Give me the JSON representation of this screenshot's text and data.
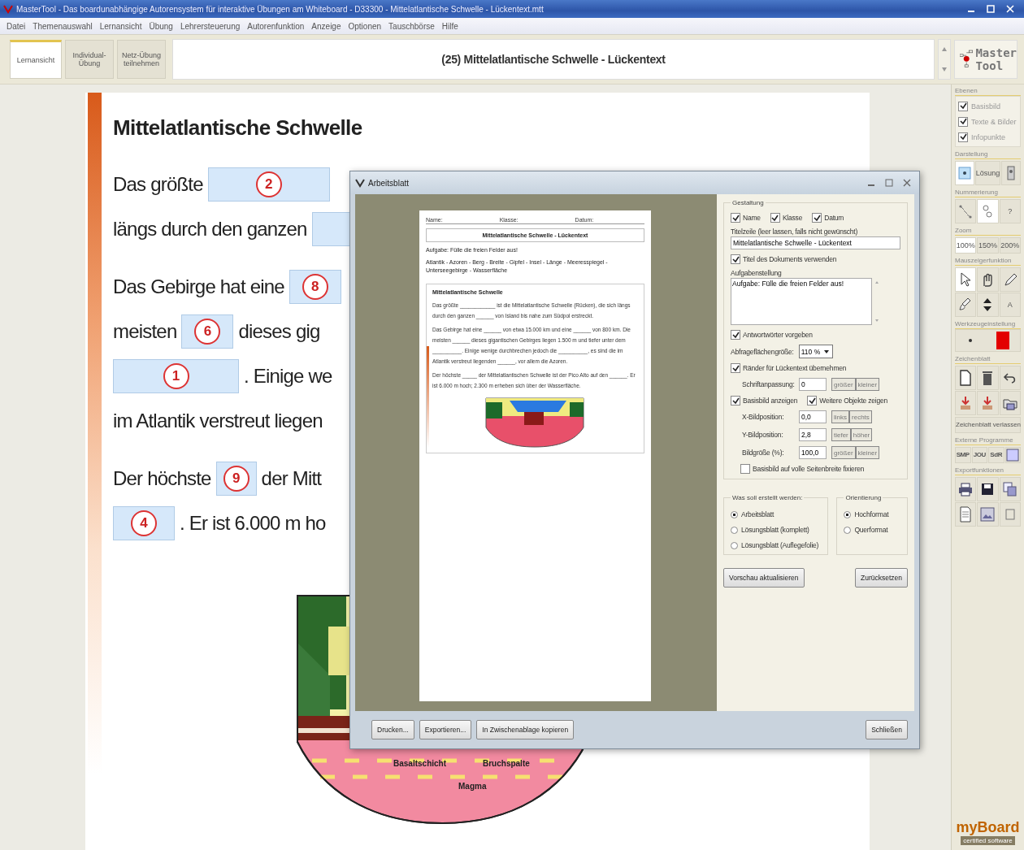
{
  "window": {
    "title": "MasterTool - Das boardunabhängige Autorensystem für interaktive Übungen am Whiteboard - D33300 - Mittelatlantische Schwelle - Lückentext.mtt"
  },
  "menu": [
    "Datei",
    "Themenauswahl",
    "Lernansicht",
    "Übung",
    "Lehrersteuerung",
    "Autorenfunktion",
    "Anzeige",
    "Optionen",
    "Tauschbörse",
    "Hilfe"
  ],
  "tabs": [
    {
      "label": "Lernansicht",
      "selected": true
    },
    {
      "label": "Individual-\nÜbung",
      "selected": false
    },
    {
      "label": "Netz-Übung\nteilnehmen",
      "selected": false
    }
  ],
  "lesson_title": "(25) Mittelatlantische Schwelle - Lückentext",
  "logo": [
    "Master",
    "Tool"
  ],
  "page": {
    "heading": "Mittelatlantische Schwelle",
    "paragraphs": [
      [
        [
          {
            "kind": "text",
            "text": "Das größte"
          },
          {
            "kind": "gap",
            "number": "2"
          }
        ],
        [
          {
            "kind": "text",
            "text": "längs durch den ganzen"
          },
          {
            "kind": "gap"
          }
        ]
      ],
      [
        [
          {
            "kind": "text",
            "text": "Das Gebirge hat eine"
          },
          {
            "kind": "gap",
            "number": "8"
          }
        ],
        [
          {
            "kind": "text",
            "text": "meisten"
          },
          {
            "kind": "gap",
            "number": "6"
          },
          {
            "kind": "text",
            "text": "dieses gig"
          }
        ],
        [
          {
            "kind": "gap",
            "number": "1"
          },
          {
            "kind": "text",
            "text": ". Einige we"
          }
        ],
        [
          {
            "kind": "text",
            "text": "im Atlantik verstreut liegen"
          }
        ]
      ],
      [
        [
          {
            "kind": "text",
            "text": "Der höchste"
          },
          {
            "kind": "gap",
            "number": "9"
          },
          {
            "kind": "text",
            "text": "der Mitt"
          }
        ],
        [
          {
            "kind": "gap",
            "number": "4"
          },
          {
            "kind": "text",
            "text": ". Er ist 6.000 m ho"
          }
        ]
      ]
    ],
    "diagram_labels": [
      "Basaltschicht",
      "Bruchspalte",
      "Magma"
    ]
  },
  "dialog": {
    "title": "Arbeitsblatt",
    "preview": {
      "header_fields": [
        "Name:",
        "Klasse:",
        "Datum:"
      ],
      "title": "Mittelatlantische Schwelle - Lückentext",
      "task": "Aufgabe: Fülle die freien Felder aus!",
      "words": "Atlantik - Azoren - Berg - Breite - Gipfel - Insel - Länge - Meeresspiegel - Unterseegebirge - Wasserfläche",
      "heading": "Mittelatlantische Schwelle",
      "paragraphs": [
        "Das größte ____________ ist die Mittelatlantische Schwelle (Rücken), die sich längs durch den ganzen ______ von Island bis nahe zum Südpol erstreckt.",
        "Das Gebirge hat eine ______ von etwa 15.000 km und eine ______ von 800 km. Die meisten ______ dieses gigantischen Gebirges liegen 1.500 m und tiefer unter dem __________. Einige wenige durchbrechen jedoch die __________, es sind die im Atlantik verstreut liegenden ______, vor allem die Azoren.",
        "Der höchste _____ der Mittelatlantischen Schwelle ist der Pico Alto auf den ______. Er ist 6.000 m hoch; 2.300 m erheben sich über der Wasserfläche."
      ]
    },
    "settings": {
      "legend": "Gestaltung",
      "items": [
        {
          "kind": "checks",
          "checks": [
            {
              "label": "Name",
              "checked": true
            },
            {
              "label": "Klasse",
              "checked": true
            },
            {
              "label": "Datum",
              "checked": true
            }
          ]
        },
        {
          "kind": "field",
          "label": "Titelzeile (leer lassen, falls nicht gewünscht)",
          "value": "Mittelatlantische Schwelle - Lückentext"
        },
        {
          "kind": "checks",
          "checks": [
            {
              "label": "Titel des Dokuments verwenden",
              "checked": true
            }
          ]
        },
        {
          "kind": "textarea",
          "label": "Aufgabenstellung",
          "value": "Aufgabe: Fülle die freien Felder aus!"
        },
        {
          "kind": "checks",
          "checks": [
            {
              "label": "Antwortwörter vorgeben",
              "checked": true
            }
          ]
        },
        {
          "kind": "select",
          "label": "Abfrageflächengröße:",
          "value": "110 %"
        },
        {
          "kind": "checks",
          "checks": [
            {
              "label": "Ränder für Lückentext übernehmen",
              "checked": true
            }
          ]
        },
        {
          "kind": "stepper",
          "label": "Schriftanpassung:",
          "value": "0",
          "buttons": [
            "größer",
            "kleiner"
          ]
        },
        {
          "kind": "checks",
          "checks": [
            {
              "label": "Basisbild anzeigen",
              "checked": true
            },
            {
              "label": "Weitere Objekte zeigen",
              "checked": true
            }
          ]
        },
        {
          "kind": "stepper",
          "label": "X-Bildposition:",
          "value": "0,0",
          "buttons": [
            "links",
            "rechts"
          ]
        },
        {
          "kind": "stepper",
          "label": "Y-Bildposition:",
          "value": "2,8",
          "buttons": [
            "tiefer",
            "höher"
          ]
        },
        {
          "kind": "stepper",
          "label": "Bildgröße (%):",
          "value": "100,0",
          "buttons": [
            "größer",
            "kleiner"
          ]
        },
        {
          "kind": "checks",
          "checks": [
            {
              "label": "Basisbild auf volle Seitenbreite fixieren",
              "checked": false
            }
          ]
        }
      ]
    },
    "create": {
      "legend": "Was soll erstellt werden:",
      "options": [
        {
          "label": "Arbeitsblatt",
          "selected": true
        },
        {
          "label": "Lösungsblatt (komplett)",
          "selected": false
        },
        {
          "label": "Lösungsblatt (Auflegefolie)",
          "selected": false
        }
      ]
    },
    "orientation": {
      "legend": "Orientierung",
      "options": [
        {
          "label": "Hochformat",
          "selected": true
        },
        {
          "label": "Querformat",
          "selected": false
        }
      ]
    },
    "side_buttons": [
      "Vorschau aktualisieren",
      "Zurücksetzen"
    ],
    "bottom_buttons": [
      "Drucken...",
      "Exportieren...",
      "In Zwischenablage kopieren"
    ],
    "close_button": "Schließen"
  },
  "sidebar": [
    {
      "kind": "layers",
      "title": "Ebenen",
      "items": [
        {
          "label": "Basisbild",
          "checked": true
        },
        {
          "label": "Texte & Bilder",
          "checked": true
        },
        {
          "label": "Infopunkte",
          "checked": true
        }
      ]
    },
    {
      "kind": "display",
      "title": "Darstellung",
      "items": [
        {
          "selected": true
        },
        {
          "label": "Lösung",
          "selected": false
        },
        {
          "selected": false
        }
      ]
    },
    {
      "kind": "numbering",
      "title": "Nummerierung",
      "items": [
        {
          "selected": false
        },
        {
          "selected": true
        },
        {
          "label": "?",
          "selected": false
        }
      ]
    },
    {
      "kind": "zoom",
      "title": "Zoom",
      "items": [
        {
          "label": "100%",
          "selected": true
        },
        {
          "label": "150%",
          "selected": false
        },
        {
          "label": "200%",
          "selected": false
        }
      ]
    },
    {
      "kind": "pointer",
      "title": "Mauszeigerfunktion",
      "items": [
        {
          "selected": true
        },
        {
          "selected": false
        },
        {
          "selected": false
        },
        {
          "selected": false
        },
        {
          "selected": false
        },
        {
          "label": "A",
          "selected": false
        }
      ]
    },
    {
      "kind": "tools",
      "title": "Werkzeugeinstellung"
    },
    {
      "kind": "drawing",
      "title": "Zeichenblatt",
      "button": "Zeichenblatt verlassen"
    },
    {
      "kind": "external",
      "title": "Externe Programme",
      "items": [
        {
          "label": "SMP"
        },
        {
          "label": "JOU"
        },
        {
          "label": "SdR"
        }
      ]
    },
    {
      "kind": "export",
      "title": "Exportfunktionen"
    }
  ],
  "brand": {
    "name": "myBoard",
    "tagline": "certified software"
  }
}
